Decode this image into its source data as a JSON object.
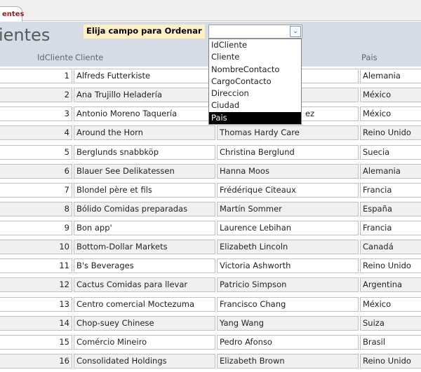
{
  "tab": {
    "label": "entes"
  },
  "form": {
    "title": "ientes",
    "sort_label": "Elija campo para Ordenar",
    "sort_value": ""
  },
  "dropdown": {
    "options": [
      "IdCliente",
      "Cliente",
      "NombreContacto",
      "CargoContacto",
      "Direccion",
      "Ciudad",
      "Pais"
    ],
    "selected": "Pais"
  },
  "columns": {
    "id": "IdCliente",
    "cliente": "Cliente",
    "pais": "Pais"
  },
  "rows": [
    {
      "id": "1",
      "cliente": "Alfreds Futterkiste",
      "contacto": "",
      "pais": "Alemania"
    },
    {
      "id": "2",
      "cliente": "Ana Trujillo Heladería",
      "contacto": "",
      "pais": "México"
    },
    {
      "id": "3",
      "cliente": "Antonio Moreno Taquería",
      "contacto": "ez",
      "pais": "México"
    },
    {
      "id": "4",
      "cliente": "Around the Horn",
      "contacto": "Thomas Hardy Care",
      "pais": "Reino Unido"
    },
    {
      "id": "5",
      "cliente": "Berglunds snabbköp",
      "contacto": "Christina Berglund",
      "pais": "Suecia"
    },
    {
      "id": "6",
      "cliente": "Blauer See Delikatessen",
      "contacto": "Hanna Moos",
      "pais": "Alemania"
    },
    {
      "id": "7",
      "cliente": "Blondel père et fils",
      "contacto": "Frédérique Citeaux",
      "pais": "Francia"
    },
    {
      "id": "8",
      "cliente": "Bólido Comidas preparadas",
      "contacto": "Martín Sommer",
      "pais": "España"
    },
    {
      "id": "9",
      "cliente": "Bon app'",
      "contacto": "Laurence Lebihan",
      "pais": "Francia"
    },
    {
      "id": "10",
      "cliente": "Bottom-Dollar Markets",
      "contacto": "Elizabeth Lincoln",
      "pais": "Canadá"
    },
    {
      "id": "11",
      "cliente": "B's Beverages",
      "contacto": "Victoria Ashworth",
      "pais": "Reino Unido"
    },
    {
      "id": "12",
      "cliente": "Cactus Comidas para llevar",
      "contacto": "Patricio Simpson",
      "pais": "Argentina"
    },
    {
      "id": "13",
      "cliente": "Centro comercial Moctezuma",
      "contacto": "Francisco Chang",
      "pais": "México"
    },
    {
      "id": "14",
      "cliente": "Chop-suey Chinese",
      "contacto": "Yang Wang",
      "pais": "Suiza"
    },
    {
      "id": "15",
      "cliente": "Comércio Mineiro",
      "contacto": "Pedro Afonso",
      "pais": "Brasil"
    },
    {
      "id": "16",
      "cliente": "Consolidated Holdings",
      "contacto": "Elizabeth Brown",
      "pais": "Reino Unido"
    }
  ]
}
